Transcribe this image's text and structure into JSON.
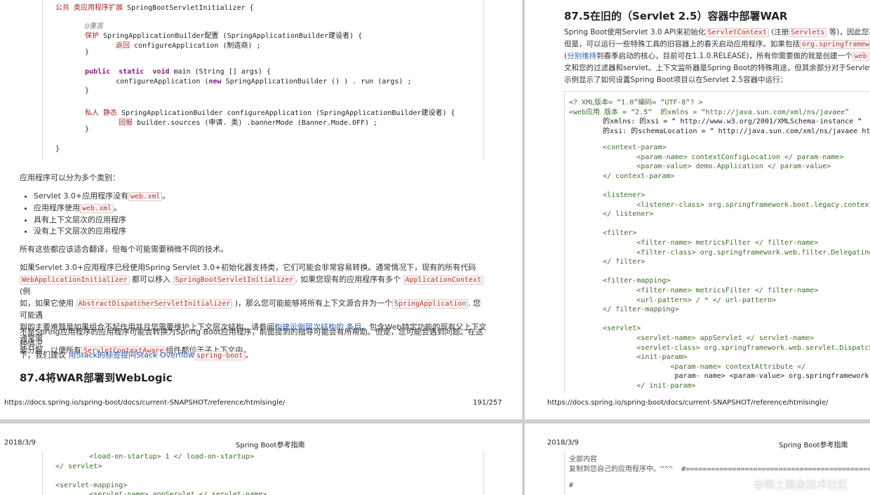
{
  "page1": {
    "code": [
      {
        "parts": [
          {
            "t": "公共 类应用程序扩展 ",
            "c": "cjk-kw"
          },
          {
            "t": "SpringBootServletInitializer {",
            "c": ""
          }
        ]
      },
      {
        "parts": [
          {
            "t": "@覆盖",
            "c": "cmt"
          }
        ]
      },
      {
        "parts": [
          {
            "t": "保护 ",
            "c": "cjk-kw"
          },
          {
            "t": "SpringApplicationBuilder配置 (SpringApplicationBuilder建设者) {",
            "c": ""
          }
        ]
      },
      {
        "parts": [
          {
            "t": "返回 ",
            "c": "cjk-kw"
          },
          {
            "t": "configureApplication (制造商) ;",
            "c": ""
          }
        ]
      },
      {
        "parts": [
          {
            "t": "}",
            "c": ""
          }
        ]
      },
      {
        "parts": [
          {
            "t": "public  static  void ",
            "c": "kw"
          },
          {
            "t": "main (String [] args) {",
            "c": ""
          }
        ]
      },
      {
        "parts": [
          {
            "t": "configureApplication (",
            "c": ""
          },
          {
            "t": "new ",
            "c": "kw"
          },
          {
            "t": "SpringApplicationBuilder () ) . run (args) ;",
            "c": ""
          }
        ]
      },
      {
        "parts": [
          {
            "t": "}",
            "c": ""
          }
        ]
      },
      {
        "parts": [
          {
            "t": "私人 静态 ",
            "c": "cjk-kw"
          },
          {
            "t": "SpringApplicationBuilder configureApplication (SpringApplicationBuilder建设者) {",
            "c": ""
          }
        ]
      },
      {
        "parts": [
          {
            "t": "回报 ",
            "c": "cjk-kw"
          },
          {
            "t": "builder.sources (申请. 类) .bannerMode (Banner.Mode.OFF) ;",
            "c": ""
          }
        ]
      },
      {
        "parts": [
          {
            "t": "}",
            "c": ""
          }
        ]
      },
      {
        "parts": [
          {
            "t": "}",
            "c": ""
          }
        ]
      }
    ],
    "intro": "应用程序可以分为多个类别：",
    "bullets": [
      {
        "text": "Servlet 3.0+应用程序没有",
        "code": "web.xml",
        "after": "。"
      },
      {
        "text": "应用程序使用",
        "code": "web.xml",
        "after": "。"
      },
      {
        "text": "具有上下文层次的应用程序",
        "code": "",
        "after": ""
      },
      {
        "text": "没有上下文层次的应用程序",
        "code": "",
        "after": ""
      }
    ],
    "para1": "所有这些都应该适合翻译，但每个可能需要稍微不同的技术。",
    "para2_a": "如果Servlet 3.0+应用程序已经使用Spring Servlet 3.0+初始化器支持类，它们可能会非常容易转换。通常情况下，现有的所有代码",
    "para2_code1": "WebApplicationInitializer",
    "para2_b": "都可以移入",
    "para2_code2": "SpringBootServletInitializer",
    "para2_c": ". 如果您现有的应用程序有多个",
    "para2_code3": "ApplicationContext",
    "para2_d": "(例",
    "para2_e": "如，如果它使用",
    "para2_code4": "AbstractDispatcherServletInitializer",
    "para2_f": ")，那么您可能能够将所有上下文源合并为一个",
    "para2_code5": "SpringApplication",
    "para2_g": ". 您可能遇",
    "para2_h": "到的主要难题是如果组合不起作用并且您需要维护上下文层次结构。请参阅",
    "para2_link1": "构建示例层次结构的 条目",
    "para2_i": "。包含Web特定功能的现有父上下文通常需",
    "para2_j": "要分解，以便所有",
    "para2_code6": "ServletContextAware",
    "para2_k": "组件都位于子上下文中。",
    "para3_a": "不是Spring应用程序的应用程序可能会转换为Spring Boot应用程序，前面提到的指导可能会有所帮助。但是，您可能会遇到问题。在这种情况",
    "para3_b": "下，我们建议",
    "para3_link": "用Stack的标签提问Stack Overflow",
    "para3_code": "spring-boot",
    "para3_c": "。",
    "heading": "87.4将WAR部署到WebLogic",
    "footer_url": "https://docs.spring.io/spring-boot/docs/current-SNAPSHOT/reference/htmlsingle/",
    "footer_page": "191/257"
  },
  "page2": {
    "heading": "87.5在旧的（Servlet 2.5）容器中部署WAR",
    "p_a": "Spring Boot使用Servlet 3.0 API来初始化",
    "p_code1": "ServletContext",
    "p_b": "(注册",
    "p_code2": "Servlets",
    "p_c": "等)，因此您不能",
    "p_d": "但是，可以运行一些特殊工具的旧容器上的春天启动应用程序。如果包括",
    "p_code3": "org.springframewor",
    "p_e": "(",
    "p_link": "分别维持",
    "p_f": "到春季启动的核心，目前可在1.1.0.RELEASE)，所有你需要做的就是创建一个",
    "p_code4": "web",
    "p_g": "文和您的过滤器和servlet。上下文监听器是Spring Boot的特殊用途，但其余部分对于Servlet 2.5",
    "p_h": "示例显示了如何设置Spring Boot项目以在Servlet 2.5容器中运行：",
    "code": [
      "<? XML版本= “1.0”编码= “UTF-8”? >",
      "<web应用 版本 = “2.5”  的xmlns = “http://java.sun.com/xml/ns/javaee”",
      "        的xmlns: 的xsi = “ http://www.w3.org/2001/XMLSchema-instance “",
      "        的xsi: 的schemaLocation = “ http://java.sun.com/xml/ns/javaee http://java",
      "",
      "        <context-param>",
      "                <param-name> contextConfigLocation </ param-name>",
      "                <param-value> demo.Application </ param-value>",
      "        </ context-param>",
      "",
      "        <listener>",
      "                <listener-class> org.springframework.boot.legacy.context.web.Spr",
      "        </ listener>",
      "",
      "        <filter>",
      "                <filter-name> metricsFilter </ filter-name>",
      "                <filter-class> org.springframework.web.filter.DelegatingFilterPr",
      "        </ filter>",
      "",
      "        <filter-mapping>",
      "                <filter-name> metricsFilter </ filter-name>",
      "                <url-pattern> / * </ url-pattern>",
      "        </ filter-mapping>",
      "",
      "        <servlet>",
      "                <servlet-name> appServlet </ servlet-name>",
      "                <servlet-class> org.springframework.web.servlet.DispatcherServle",
      "                <init-param>",
      "                        <param-name> contextAttribute </",
      "                         param- name> <param-value> org.springframework.web.cont",
      "                </ init-param>"
    ],
    "footer_url": "https://docs.spring.io/spring-boot/docs/current-SNAPSHOT/reference/htmlsingle/"
  },
  "page3": {
    "date": "2018/3/9",
    "title": "Spring Boot参考指南",
    "code": [
      "        <load-on-startup> 1 </ load-on-startup>",
      "</ servlet>",
      "",
      "<servlet-mapping>",
      "        <servlet-name> appServlet </ servlet-name>"
    ]
  },
  "page4": {
    "date": "2018/3/9",
    "title": "Spring Boot参考指南",
    "code": [
      "全部内容",
      "复制到您自己的应用程序中。^^^  #=============================================== ===",
      "",
      "#"
    ],
    "watermark": "@稀土掘金技术社区"
  }
}
